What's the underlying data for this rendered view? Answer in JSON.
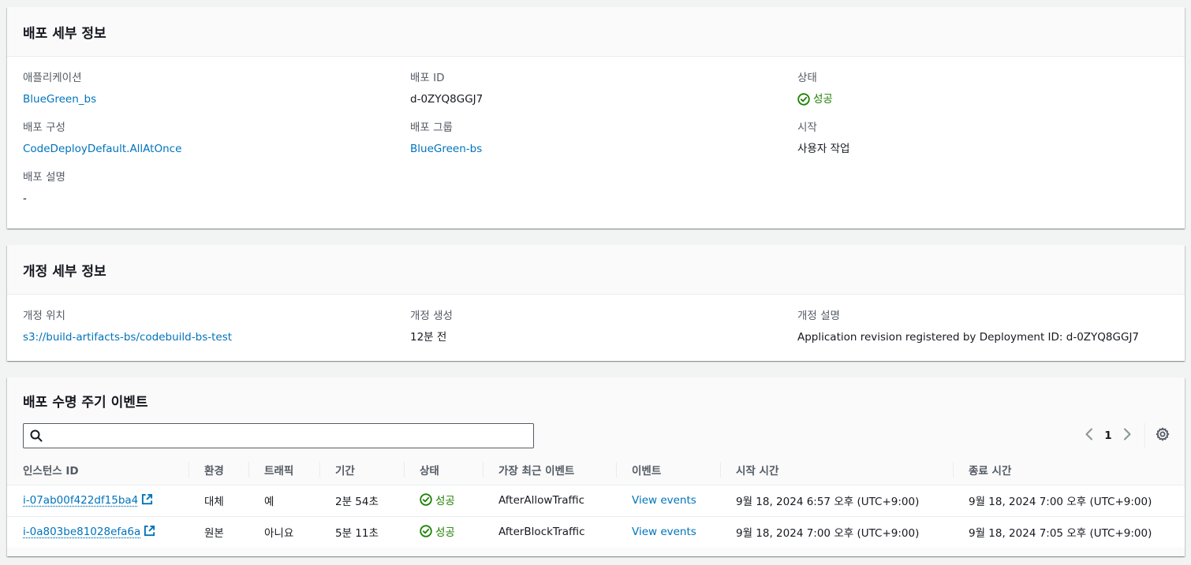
{
  "deployment_details": {
    "title": "배포 세부 정보",
    "application_label": "애플리케이션",
    "application_value": "BlueGreen_bs",
    "deployment_id_label": "배포 ID",
    "deployment_id_value": "d-0ZYQ8GGJ7",
    "status_label": "상태",
    "status_value": "성공",
    "config_label": "배포 구성",
    "config_value": "CodeDeployDefault.AllAtOnce",
    "group_label": "배포 그룹",
    "group_value": "BlueGreen-bs",
    "start_label": "시작",
    "start_value": "사용자 작업",
    "description_label": "배포 설명",
    "description_value": "-"
  },
  "revision_details": {
    "title": "개정 세부 정보",
    "location_label": "개정 위치",
    "location_value": "s3://build-artifacts-bs/codebuild-bs-test",
    "created_label": "개정 생성",
    "created_value": "12분 전",
    "description_label": "개정 설명",
    "description_value": "Application revision registered by Deployment ID: d-0ZYQ8GGJ7"
  },
  "lifecycle": {
    "title": "배포 수명 주기 이벤트",
    "search_placeholder": "",
    "current_page": "1",
    "columns": [
      "인스턴스 ID",
      "환경",
      "트래픽",
      "기간",
      "상태",
      "가장 최근 이벤트",
      "이벤트",
      "시작 시간",
      "종료 시간"
    ],
    "rows": [
      {
        "instance_id": "i-07ab00f422df15ba4",
        "environment": "대체",
        "traffic": "예",
        "duration": "2분 54초",
        "status": "성공",
        "latest_event": "AfterAllowTraffic",
        "events": "View events",
        "start_time": "9월 18, 2024 6:57 오후 (UTC+9:00)",
        "end_time": "9월 18, 2024 7:00 오후 (UTC+9:00)"
      },
      {
        "instance_id": "i-0a803be81028efa6a",
        "environment": "원본",
        "traffic": "아니요",
        "duration": "5분 11초",
        "status": "성공",
        "latest_event": "AfterBlockTraffic",
        "events": "View events",
        "start_time": "9월 18, 2024 7:00 오후 (UTC+9:00)",
        "end_time": "9월 18, 2024 7:05 오후 (UTC+9:00)"
      }
    ]
  },
  "colors": {
    "link": "#0073bb",
    "success": "#1d8102",
    "label": "#545b64"
  }
}
